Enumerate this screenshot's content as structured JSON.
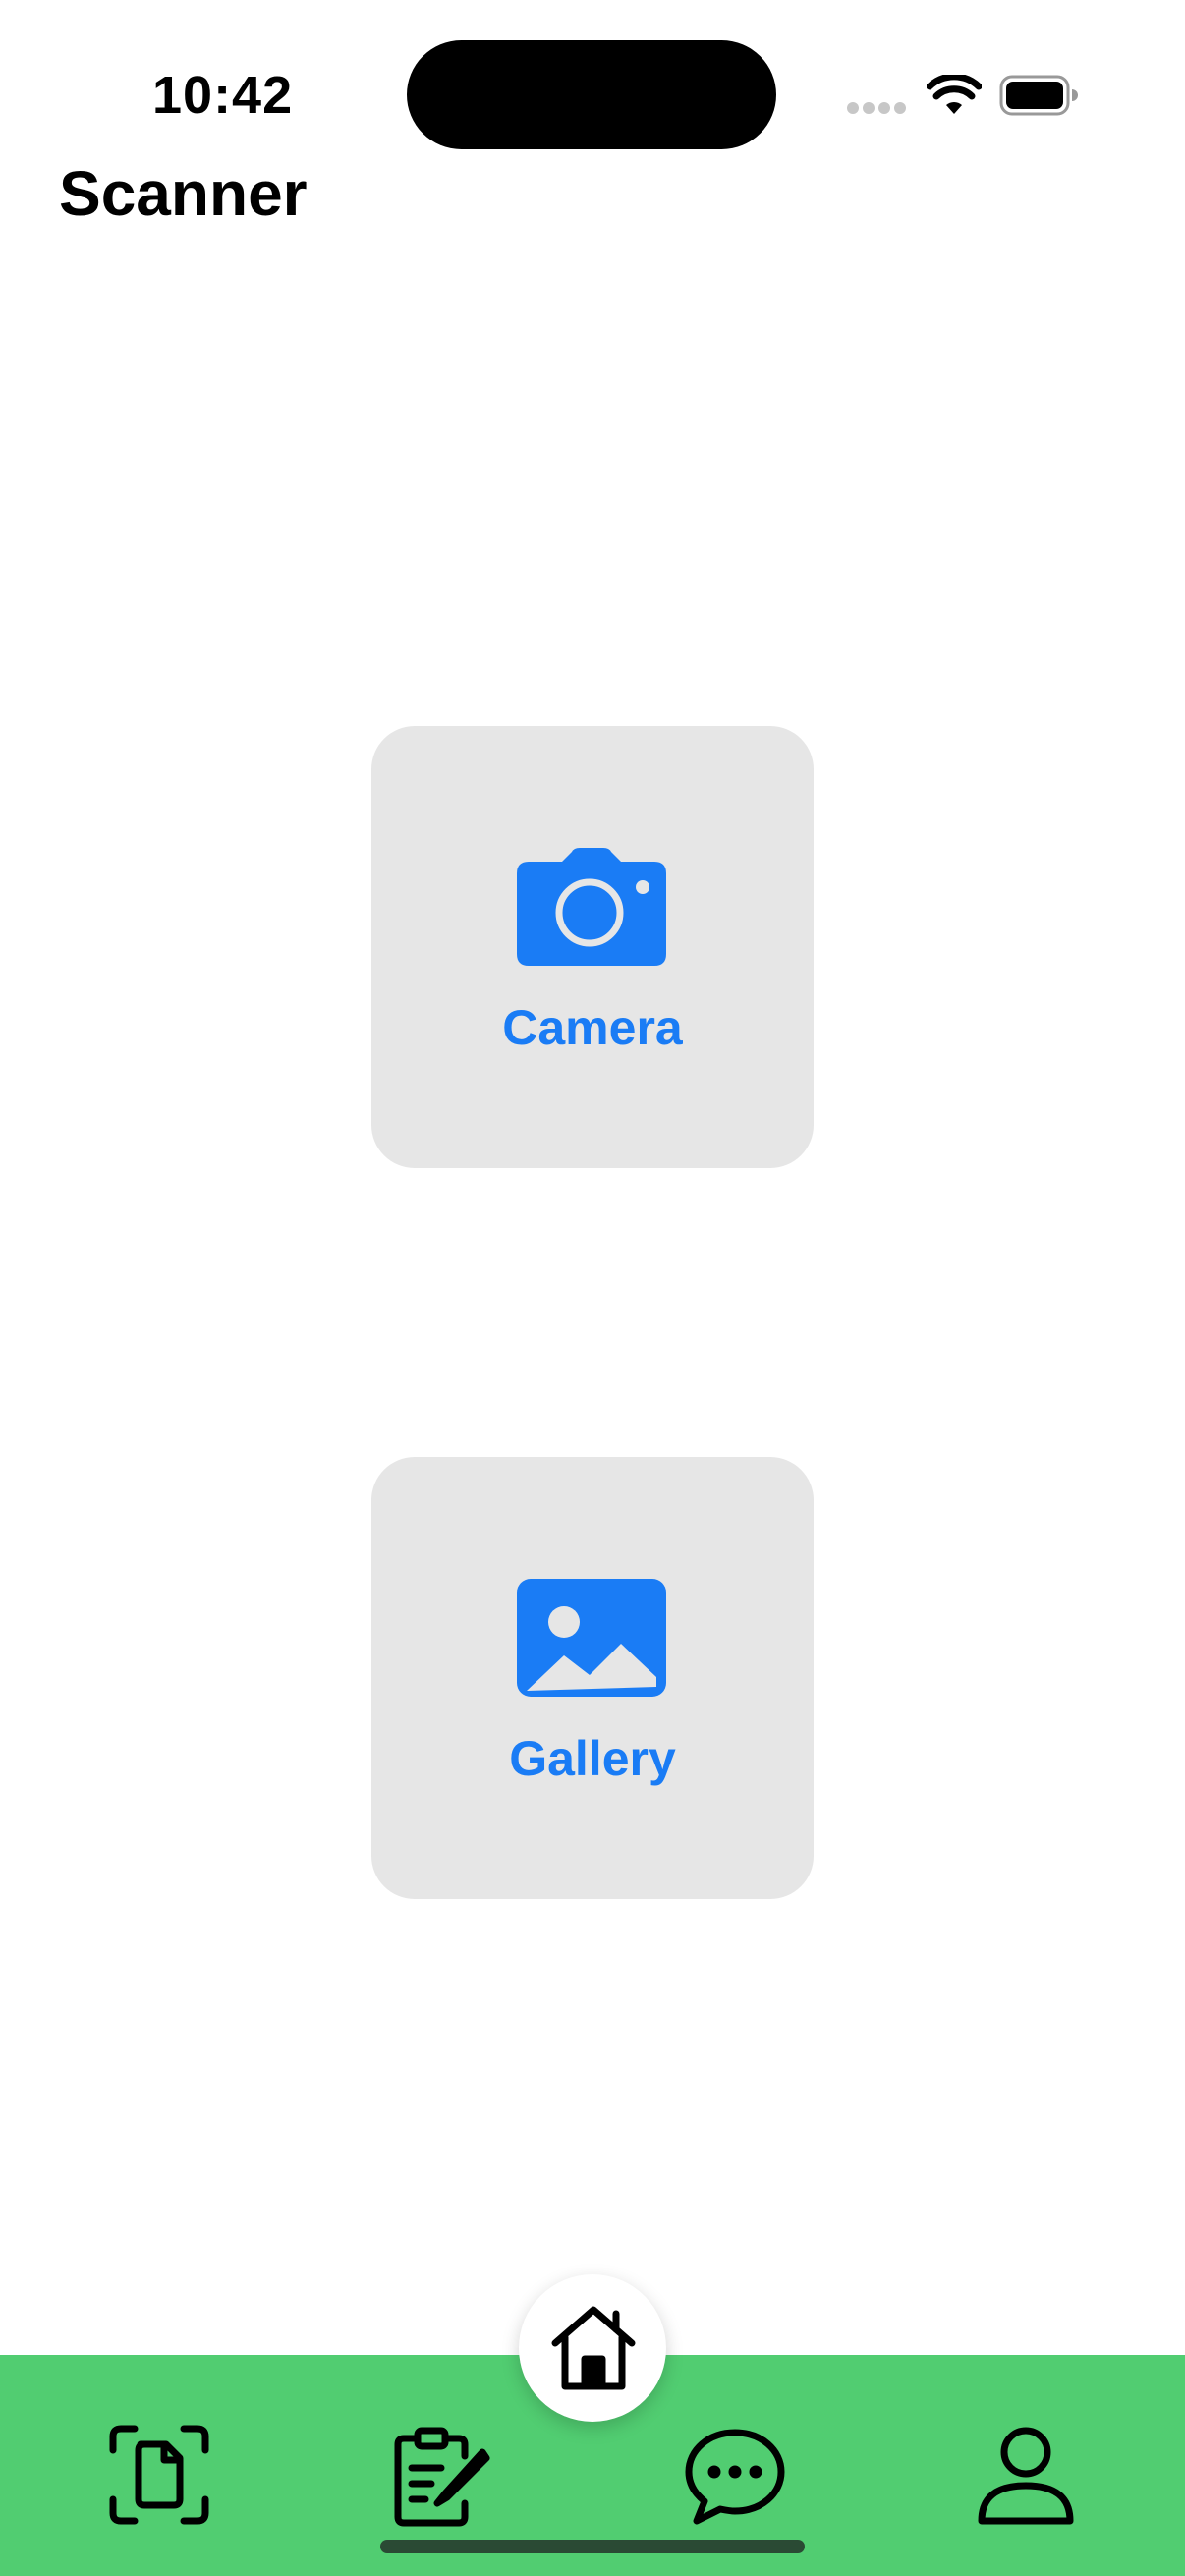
{
  "status_bar": {
    "time": "10:42",
    "icons": [
      "signal-icon",
      "wifi-icon",
      "battery-icon"
    ]
  },
  "header": {
    "title": "Scanner"
  },
  "actions": [
    {
      "label": "Camera",
      "icon": "camera-icon"
    },
    {
      "label": "Gallery",
      "icon": "photo-icon"
    }
  ],
  "tab_bar": {
    "items": [
      {
        "icon": "document-scan-icon"
      },
      {
        "icon": "clipboard-edit-icon"
      },
      {
        "icon": "home-icon",
        "selected": true
      },
      {
        "icon": "chat-bubble-icon"
      },
      {
        "icon": "person-icon"
      }
    ]
  },
  "colors": {
    "accent": "#1a7cf5",
    "card_background": "#e6e6e6",
    "tab_bar_background": "#51cd71",
    "home_button_background": "#ffffff"
  }
}
